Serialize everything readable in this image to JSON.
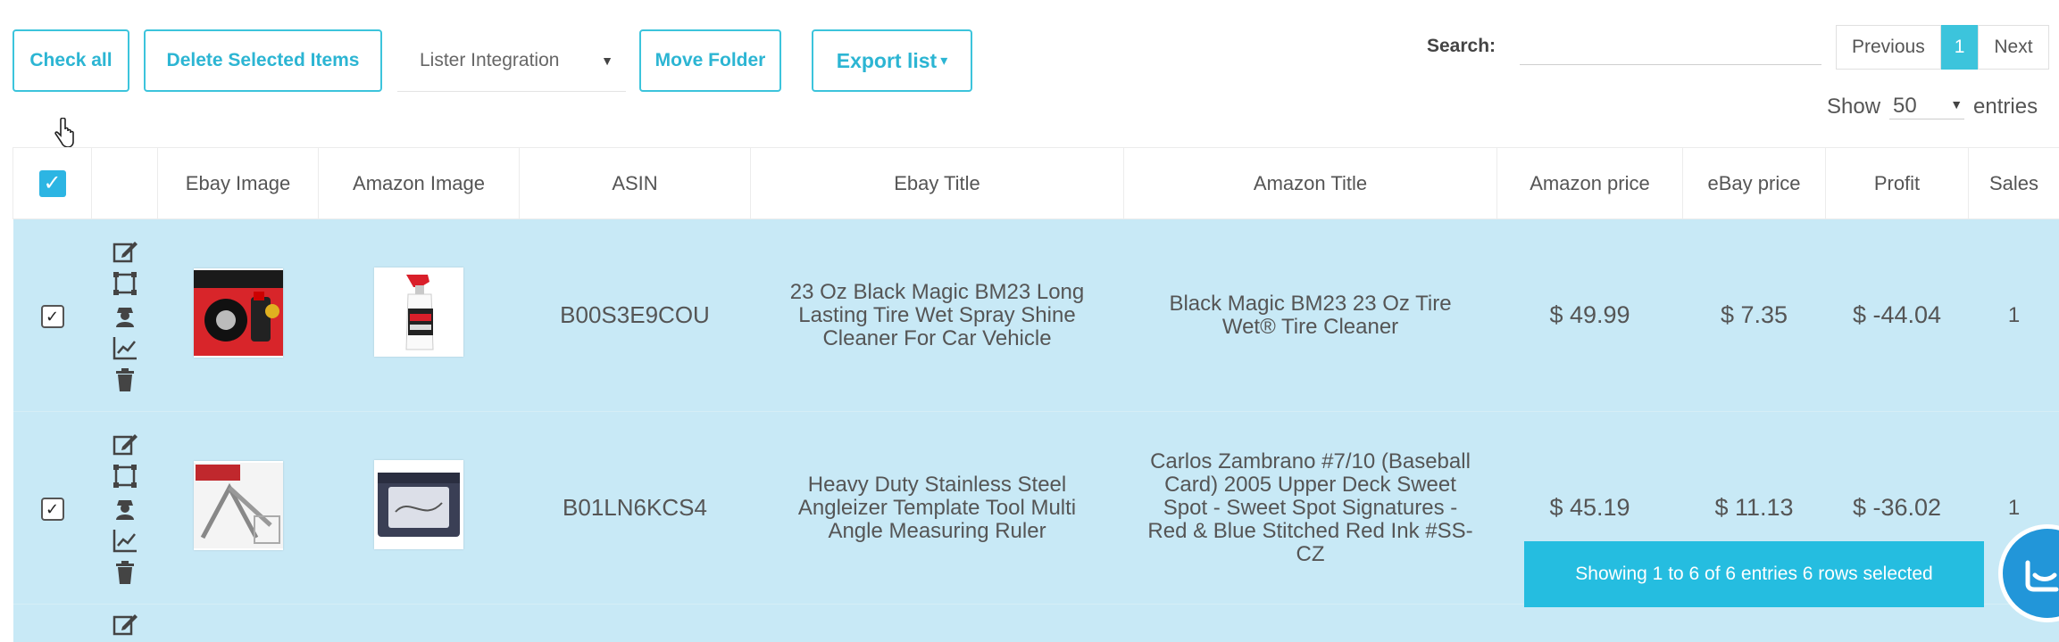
{
  "toolbar": {
    "check_all": "Check all",
    "delete_selected": "Delete Selected Items",
    "folder_select": "Lister Integration",
    "move_folder": "Move Folder",
    "export_list": "Export list",
    "export_caret": "▾"
  },
  "search": {
    "label": "Search:",
    "value": ""
  },
  "pagination": {
    "previous": "Previous",
    "current": "1",
    "next": "Next"
  },
  "entries": {
    "show": "Show",
    "value": "50",
    "suffix": "entries"
  },
  "table": {
    "headers": {
      "ebay_image": "Ebay Image",
      "amazon_image": "Amazon Image",
      "asin": "ASIN",
      "ebay_title": "Ebay Title",
      "amazon_title": "Amazon Title",
      "amazon_price": "Amazon price",
      "ebay_price": "eBay price",
      "profit": "Profit",
      "sales": "Sales"
    },
    "rows": [
      {
        "asin": "B00S3E9COU",
        "ebay_title": "23 Oz Black Magic BM23 Long Lasting Tire Wet Spray Shine Cleaner For Car Vehicle",
        "amazon_title": "Black Magic BM23 23 Oz Tire Wet® Tire Cleaner",
        "amazon_price": "$ 49.99",
        "ebay_price": "$ 7.35",
        "profit": "$ -44.04",
        "sales": "1"
      },
      {
        "asin": "B01LN6KCS4",
        "ebay_title": "Heavy Duty Stainless Steel Angleizer Template Tool Multi Angle Measuring Ruler",
        "amazon_title": "Carlos Zambrano #7/10 (Baseball Card) 2005 Upper Deck Sweet Spot - Sweet Spot Signatures - Red & Blue Stitched Red Ink #SS-CZ",
        "amazon_price": "$ 45.19",
        "ebay_price": "$ 11.13",
        "profit": "$ -36.02",
        "sales": "1"
      }
    ]
  },
  "status": {
    "toast": "Showing 1 to 6 of 6 entries 6 rows selected"
  },
  "colors": {
    "accent": "#3cc4dc",
    "selected_row": "#c8e9f6",
    "toast": "#25bde0",
    "chat": "#2296d9"
  }
}
